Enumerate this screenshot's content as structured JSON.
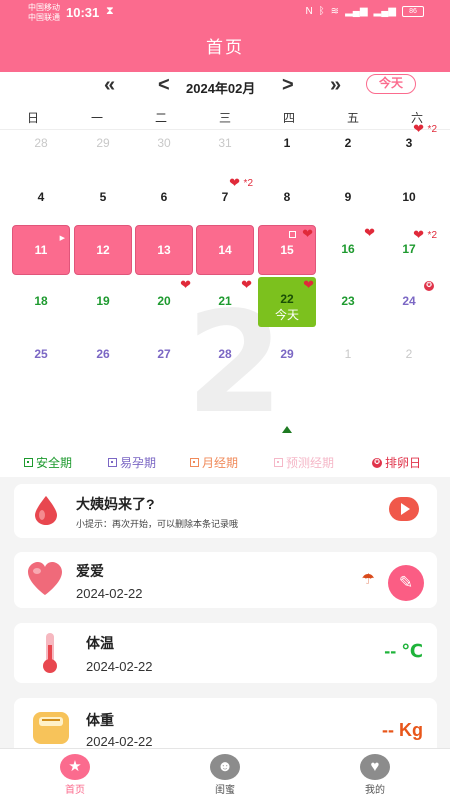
{
  "status_bar": {
    "carrier_1": "中国移动",
    "carrier_2": "中国联通",
    "time": "10:31",
    "battery": "86"
  },
  "header": {
    "title": "首页"
  },
  "calendar": {
    "prev_year": "«",
    "prev_month": "<",
    "month_label": "2024年02月",
    "next_month": ">",
    "next_year": "»",
    "today_button": "今天",
    "weekdays": [
      "日",
      "一",
      "二",
      "三",
      "四",
      "五",
      "六"
    ],
    "today_label": "今天",
    "heart_count_label": "*2",
    "days": [
      {
        "d": "28",
        "s": "gray"
      },
      {
        "d": "29",
        "s": "gray"
      },
      {
        "d": "30",
        "s": "gray"
      },
      {
        "d": "31",
        "s": "gray"
      },
      {
        "d": "1",
        "s": "black"
      },
      {
        "d": "2",
        "s": "black"
      },
      {
        "d": "3",
        "s": "black",
        "hearts": 2
      },
      {
        "d": "4",
        "s": "black"
      },
      {
        "d": "5",
        "s": "black"
      },
      {
        "d": "6",
        "s": "black"
      },
      {
        "d": "7",
        "s": "black",
        "hearts": 2
      },
      {
        "d": "8",
        "s": "black"
      },
      {
        "d": "9",
        "s": "black"
      },
      {
        "d": "10",
        "s": "black"
      },
      {
        "d": "11",
        "s": "period",
        "start": true
      },
      {
        "d": "12",
        "s": "period"
      },
      {
        "d": "13",
        "s": "period"
      },
      {
        "d": "14",
        "s": "period"
      },
      {
        "d": "15",
        "s": "period",
        "hearts": 1,
        "box": true
      },
      {
        "d": "16",
        "s": "green",
        "hearts": 1
      },
      {
        "d": "17",
        "s": "green",
        "hearts": 2
      },
      {
        "d": "18",
        "s": "green"
      },
      {
        "d": "19",
        "s": "green"
      },
      {
        "d": "20",
        "s": "green",
        "hearts": 1
      },
      {
        "d": "21",
        "s": "green",
        "hearts": 1
      },
      {
        "d": "22",
        "s": "today",
        "hearts": 1
      },
      {
        "d": "23",
        "s": "green"
      },
      {
        "d": "24",
        "s": "purple",
        "ovulation": true
      },
      {
        "d": "25",
        "s": "purple"
      },
      {
        "d": "26",
        "s": "purple"
      },
      {
        "d": "27",
        "s": "purple"
      },
      {
        "d": "28",
        "s": "purple"
      },
      {
        "d": "29",
        "s": "purple"
      },
      {
        "d": "1",
        "s": "gray"
      },
      {
        "d": "2",
        "s": "gray"
      }
    ]
  },
  "legend": {
    "safe": "安全期",
    "fertile": "易孕期",
    "period": "月经期",
    "predicted": "预测经期",
    "ovulation": "排卵日",
    "colors": {
      "safe": "#1e9a2f",
      "fertile": "#7b67c4",
      "period": "#f08a5a",
      "predicted": "#f5b8c8",
      "ovulation": "#e0334a"
    }
  },
  "cards": {
    "period": {
      "title": "大姨妈来了?",
      "hint": "小提示：再次开始，可以删除本条记录哦"
    },
    "love": {
      "title": "爱爱",
      "date": "2024-02-22"
    },
    "temperature": {
      "title": "体温",
      "date": "2024-02-22",
      "value": "-- ℃"
    },
    "weight": {
      "title": "体重",
      "date": "2024-02-22",
      "value": "-- Kg"
    }
  },
  "bottom_nav": {
    "home": "首页",
    "friends": "闺蜜",
    "mine": "我的"
  },
  "colors": {
    "primary": "#fb6b8e",
    "today": "#7cc11e"
  }
}
